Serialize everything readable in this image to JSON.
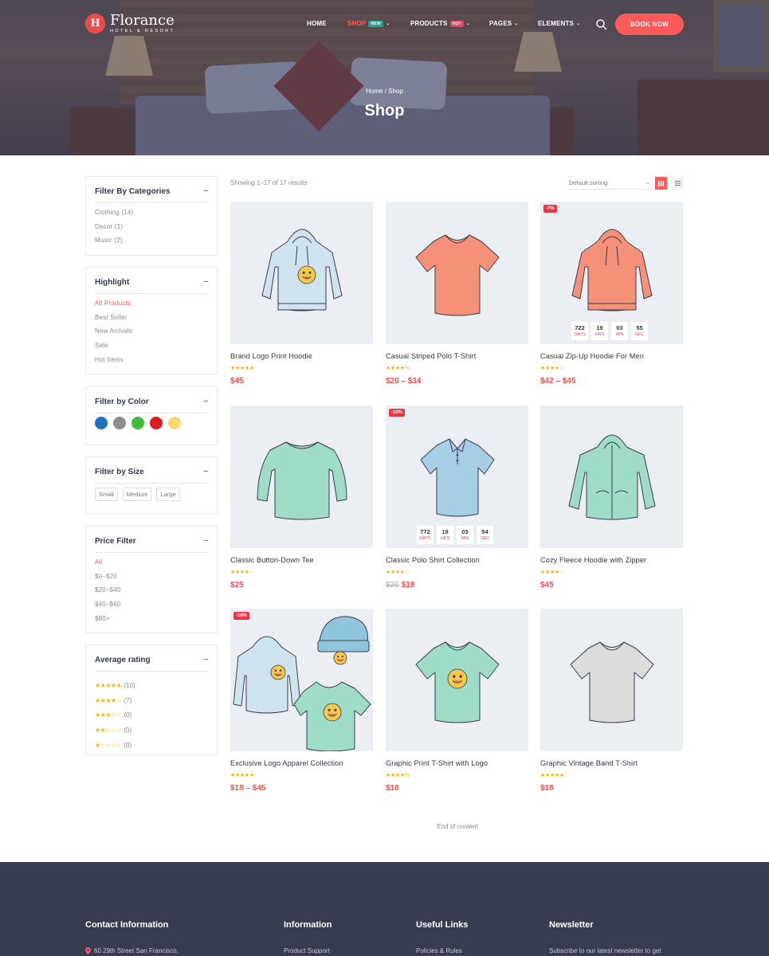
{
  "header": {
    "logo_mark": "H",
    "logo_name": "Florance",
    "logo_tagline": "HOTEL & RESORT",
    "nav": [
      {
        "label": "HOME",
        "active": false
      },
      {
        "label": "SHOP",
        "active": true,
        "badge": "NEW"
      },
      {
        "label": "PRODUCTS",
        "active": false,
        "badge": "HOT"
      },
      {
        "label": "PAGES",
        "active": false
      },
      {
        "label": "ELEMENTS",
        "active": false
      }
    ],
    "search_icon": "search-icon",
    "book_button": "BOOK NOW"
  },
  "hero": {
    "breadcrumb": "Home / Shop",
    "title": "Shop"
  },
  "sidebar": {
    "categories": {
      "title": "Filter By Categories",
      "toggle": "–",
      "items": [
        "Clothing (14)",
        "Decor (1)",
        "Music (2)"
      ]
    },
    "highlight": {
      "title": "Highlight",
      "toggle": "–",
      "items": [
        "All Products",
        "Best Seller",
        "New Arrivals",
        "Sale",
        "Hot Items"
      ],
      "active_index": 0
    },
    "color": {
      "title": "Filter by Color",
      "toggle": "–",
      "swatches": [
        "#1e73be",
        "#8d8d8d",
        "#3fbc3a",
        "#dd1d1d",
        "#fdd86f"
      ]
    },
    "size": {
      "title": "Filter by Size",
      "toggle": "–",
      "items": [
        "Small",
        "Medium",
        "Large"
      ]
    },
    "price": {
      "title": "Price Filter",
      "toggle": "–",
      "items": [
        "All",
        "$0–$20",
        "$20–$40",
        "$40–$60",
        "$80+"
      ],
      "active_index": 0
    },
    "rating": {
      "title": "Average rating",
      "toggle": "–",
      "items": [
        {
          "stars": "★★★★★",
          "count": "(10)"
        },
        {
          "stars": "★★★★☆",
          "count": "(7)"
        },
        {
          "stars": "★★★☆☆",
          "count": "(0)"
        },
        {
          "stars": "★★☆☆☆",
          "count": "(0)"
        },
        {
          "stars": "★☆☆☆☆",
          "count": "(0)"
        }
      ]
    }
  },
  "toolbar": {
    "result_count": "Showing 1–17 of 17 results",
    "sort_value": "Default sorting",
    "view_grid_icon": "grid-view-icon",
    "view_list_icon": "list-view-icon"
  },
  "products": [
    {
      "name": "Brand Logo Print Hoodie",
      "stars": "★★★★★",
      "price": "$45",
      "old_price": "",
      "badge": "",
      "countdown": null,
      "art": "hoodie",
      "color": "#cfe3ee",
      "smiley": true
    },
    {
      "name": "Casual Striped Polo T-Shirt",
      "stars": "★★★★½",
      "price": "$20 – $34",
      "old_price": "",
      "badge": "",
      "countdown": null,
      "art": "tshirt",
      "color": "#f59079",
      "smiley": false
    },
    {
      "name": "Casual Zip-Up Hoodie For Men",
      "stars": "★★★★☆",
      "price": "$42 – $45",
      "old_price": "",
      "badge": "-7%",
      "countdown": [
        {
          "num": "722",
          "lbl": "DAYS"
        },
        {
          "num": "19",
          "lbl": "HRS"
        },
        {
          "num": "03",
          "lbl": "MIN"
        },
        {
          "num": "55",
          "lbl": "SEC"
        }
      ],
      "art": "hoodie",
      "color": "#f59079",
      "smiley": false
    },
    {
      "name": "Classic Button-Down Tee",
      "stars": "★★★★☆",
      "price": "$25",
      "old_price": "",
      "badge": "",
      "countdown": null,
      "art": "longsleeve",
      "color": "#9edcc8",
      "smiley": false
    },
    {
      "name": "Classic Polo Shirt Collection",
      "stars": "★★★★☆",
      "price": "$18",
      "old_price": "$20",
      "badge": "-10%",
      "countdown": [
        {
          "num": "772",
          "lbl": "DAYS"
        },
        {
          "num": "19",
          "lbl": "HRS"
        },
        {
          "num": "03",
          "lbl": "MIN"
        },
        {
          "num": "54",
          "lbl": "SEC"
        }
      ],
      "art": "polo",
      "color": "#a6cfe6",
      "smiley": false
    },
    {
      "name": "Cozy Fleece Hoodie with Zipper",
      "stars": "★★★★☆",
      "price": "$45",
      "old_price": "",
      "badge": "",
      "countdown": null,
      "art": "ziphoodie",
      "color": "#9edcc8",
      "smiley": false
    },
    {
      "name": "Exclusive Logo Apparel Collection",
      "stars": "★★★★★",
      "price": "$18 – $45",
      "old_price": "",
      "badge": "-10%",
      "countdown": null,
      "art": "bundle",
      "color": "#cfe3ee",
      "smiley": true
    },
    {
      "name": "Graphic Print T-Shirt with Logo",
      "stars": "★★★★½",
      "price": "$18",
      "old_price": "",
      "badge": "",
      "countdown": null,
      "art": "tshirt",
      "color": "#9edcc8",
      "smiley": true
    },
    {
      "name": "Graphic Vintage Band T-Shirt",
      "stars": "★★★★★",
      "price": "$18",
      "old_price": "",
      "badge": "",
      "countdown": null,
      "art": "tshirt",
      "color": "#dcdcdc",
      "smiley": false
    }
  ],
  "end_of_content": "End of content",
  "footer": {
    "columns": [
      {
        "title": "Contact Information",
        "first_line": "60 29th Street San Francisco,",
        "icon": "location-pin-icon"
      },
      {
        "title": "Information",
        "first_line": "Product Support"
      },
      {
        "title": "Useful Links",
        "first_line": "Policies & Rules"
      },
      {
        "title": "Newsletter",
        "first_line": "Subscribe to our latest newsletter to get"
      }
    ]
  },
  "colors": {
    "accent": "#ff5a5a",
    "star": "#f7b500",
    "footer_bg": "#383c4f"
  }
}
